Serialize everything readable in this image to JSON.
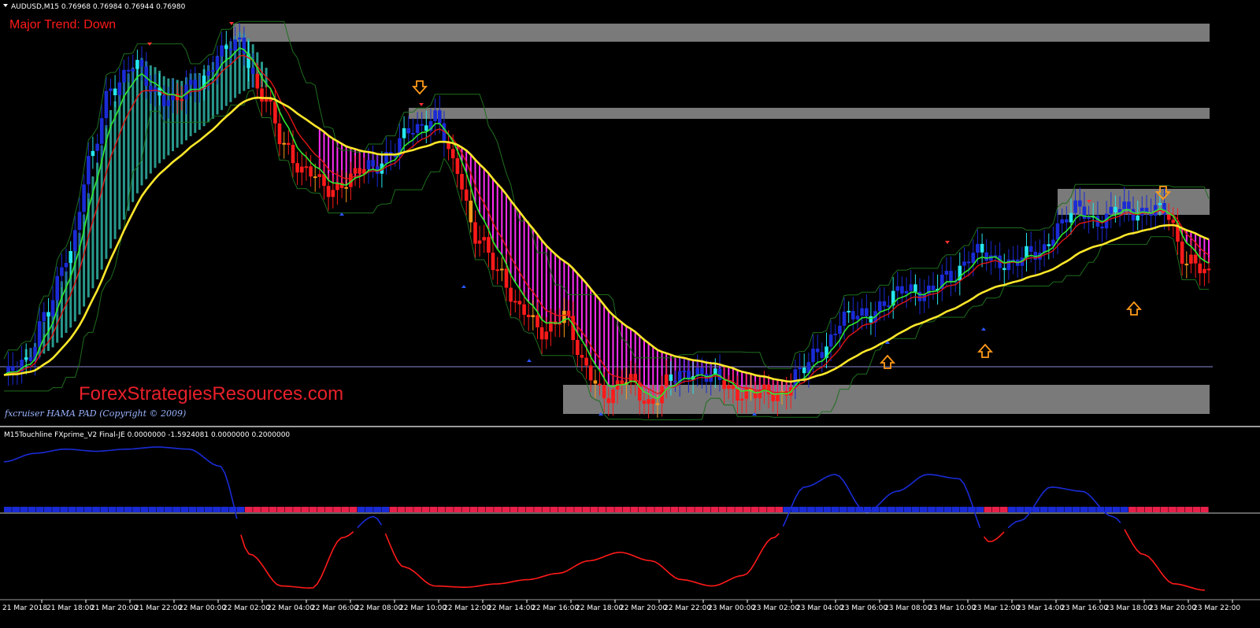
{
  "symbol_header": "AUDUSD,M15  0.76968 0.76984 0.76944 0.76980",
  "trend_label": "Major Trend: Down",
  "watermark": "ForexStrategiesResources.com",
  "credit": "fxcruiser HAMA PAD (Copyright © 2009)",
  "indicator_header": "M15Touchline  FXprime_V2 Final-JE 0.0000000 -1.5924081 0.0000000 0.2000000",
  "colors": {
    "background": "#000000",
    "zone": "#7a7a7a",
    "bull_candle": "#1a2bd6",
    "bull_candle_light": "#25e6ef",
    "bear_candle": "#ff1a1a",
    "bear_candle_light": "#ff9a1a",
    "cloud": "#ff2cf5",
    "slow_ma": "#ffe72a",
    "fast_ma": "#2fe82f",
    "envelope": "#1e6e1e",
    "osc_up": "#1a2bd6",
    "osc_down": "#ff1a1a",
    "arrow_orange": "#ff9a1a"
  },
  "chart_data": [
    {
      "type": "candlestick",
      "title": "AUDUSD,M15",
      "series": [
        {
          "name": "price",
          "values": [
            0.7634,
            0.7642,
            0.7658,
            0.7682,
            0.7715,
            0.7744,
            0.7751,
            0.7742,
            0.7738,
            0.7745,
            0.7755,
            0.776,
            0.774,
            0.7722,
            0.7712,
            0.7705,
            0.7709,
            0.7713,
            0.7719,
            0.7727,
            0.7733,
            0.7712,
            0.7688,
            0.7673,
            0.7662,
            0.765,
            0.766,
            0.7637,
            0.7629,
            0.7633,
            0.7626,
            0.7633,
            0.7638,
            0.7634,
            0.763,
            0.7628,
            0.7629,
            0.7636,
            0.7646,
            0.7656,
            0.7659,
            0.7662,
            0.7669,
            0.7666,
            0.7673,
            0.7681,
            0.7679,
            0.7678,
            0.7681,
            0.7691,
            0.7698,
            0.7693,
            0.7698,
            0.7697,
            0.7696,
            0.7679,
            0.7672
          ]
        }
      ],
      "annotations": [
        "Major Trend: Down"
      ]
    },
    {
      "type": "line",
      "title": "M15Touchline  FXprime_V2 Final-JE",
      "series": [
        {
          "name": "oscillator",
          "values": [
            1.6,
            1.8,
            1.9,
            1.85,
            1.9,
            1.95,
            1.9,
            1.5,
            -0.6,
            -1.35,
            -1.4,
            -0.2,
            0.3,
            -0.9,
            -1.35,
            -1.38,
            -1.3,
            -1.2,
            -1.05,
            -0.75,
            -0.55,
            -0.75,
            -1.2,
            -1.35,
            -1.1,
            -0.2,
            1.0,
            1.3,
            0.4,
            0.9,
            1.3,
            1.2,
            -0.3,
            0.2,
            1.0,
            0.9,
            0.3,
            -0.6,
            -1.3,
            -1.45
          ]
        }
      ]
    }
  ],
  "x_axis": {
    "tick_labels": [
      "21 Mar 2018",
      "21 Mar 18:00",
      "21 Mar 20:00",
      "21 Mar 22:00",
      "22 Mar 00:00",
      "22 Mar 02:00",
      "22 Mar 04:00",
      "22 Mar 06:00",
      "22 Mar 08:00",
      "22 Mar 10:00",
      "22 Mar 12:00",
      "22 Mar 14:00",
      "22 Mar 16:00",
      "22 Mar 18:00",
      "22 Mar 20:00",
      "22 Mar 22:00",
      "23 Mar 00:00",
      "23 Mar 02:00",
      "23 Mar 04:00",
      "23 Mar 06:00",
      "23 Mar 08:00",
      "23 Mar 10:00",
      "23 Mar 12:00",
      "23 Mar 14:00",
      "23 Mar 16:00",
      "23 Mar 18:00",
      "23 Mar 20:00",
      "23 Mar 22:00"
    ]
  }
}
